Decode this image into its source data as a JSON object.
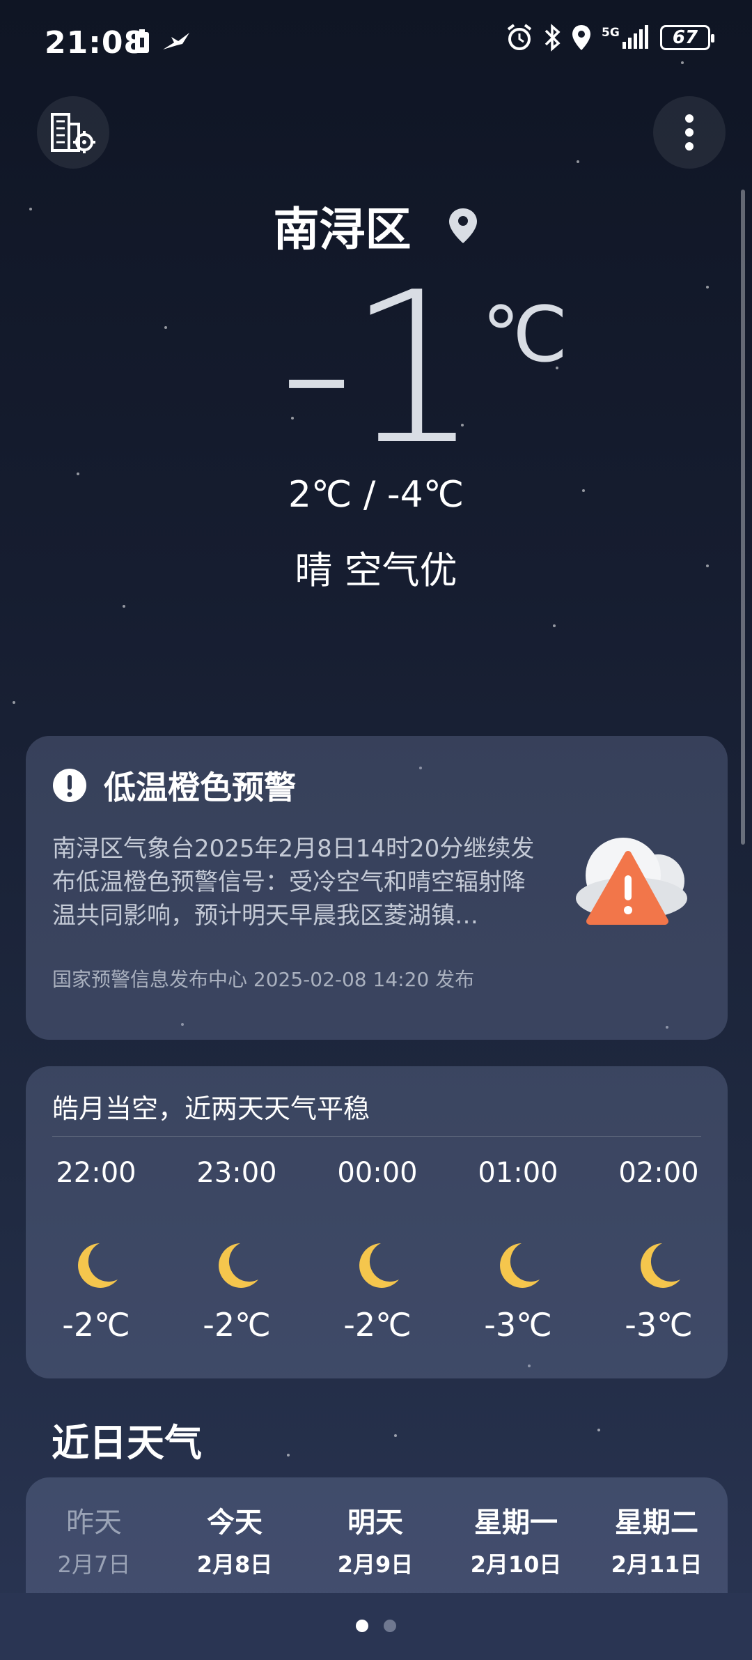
{
  "status": {
    "time": "21:08",
    "battery": "67"
  },
  "header": {
    "city": "南浔区"
  },
  "current": {
    "temp": "-1",
    "unit": "℃",
    "range": "2℃ / -4℃",
    "condition": "晴  空气优"
  },
  "alert": {
    "title": "低温橙色预警",
    "text": "南浔区气象台2025年2月8日14时20分继续发布低温橙色预警信号：受冷空气和晴空辐射降温共同影响，预计明天早晨我区菱湖镇…",
    "source": "国家预警信息发布中心 2025-02-08 14:20 发布"
  },
  "hourly": {
    "summary": "皓月当空，近两天天气平稳",
    "items": [
      {
        "time": "22:00",
        "temp": "-2℃"
      },
      {
        "time": "23:00",
        "temp": "-2℃"
      },
      {
        "time": "00:00",
        "temp": "-2℃"
      },
      {
        "time": "01:00",
        "temp": "-3℃"
      },
      {
        "time": "02:00",
        "temp": "-3℃"
      }
    ]
  },
  "daily": {
    "title": "近日天气",
    "items": [
      {
        "day": "昨天",
        "date": "2月7日"
      },
      {
        "day": "今天",
        "date": "2月8日"
      },
      {
        "day": "明天",
        "date": "2月9日"
      },
      {
        "day": "星期一",
        "date": "2月10日"
      },
      {
        "day": "星期二",
        "date": "2月11日"
      }
    ]
  },
  "colors": {
    "moon": "#f5c64d",
    "warning_orange": "#f2764a"
  }
}
